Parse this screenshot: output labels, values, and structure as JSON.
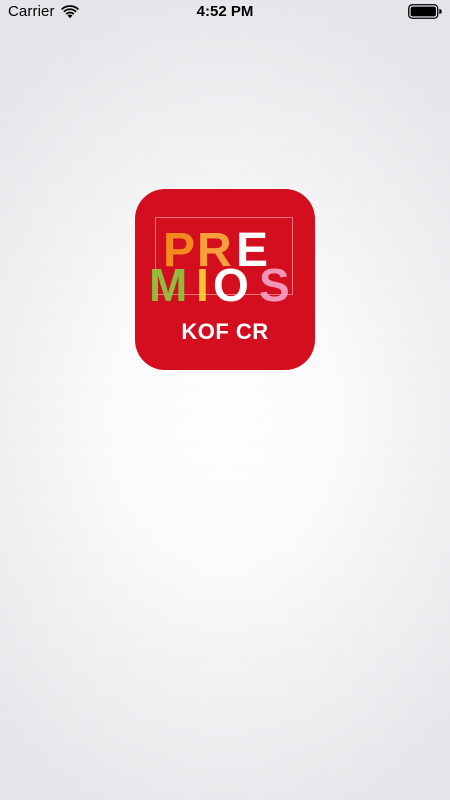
{
  "status_bar": {
    "carrier": "Carrier",
    "time": "4:52 PM",
    "wifi_icon": "wifi-icon",
    "battery_icon": "battery-icon"
  },
  "app_icon": {
    "brand_color": "#d30f1f",
    "logo_line1": "PRE",
    "logo_line2": "MIOS",
    "subtitle": "KOF CR",
    "letter_colors": {
      "P": "#f6921e",
      "R": "#fbb040",
      "E": "#ffffff",
      "M": "#8dc63f",
      "I": "#fdd835",
      "O": "#ffffff",
      "S": "#f5a5c8"
    }
  }
}
